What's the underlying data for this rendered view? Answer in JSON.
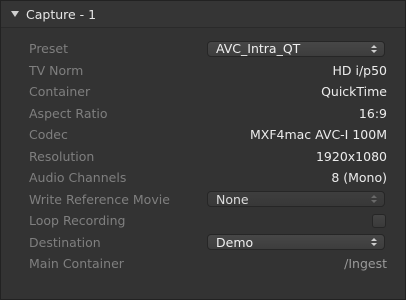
{
  "header": {
    "title": "Capture - 1"
  },
  "rows": {
    "preset": {
      "label": "Preset",
      "value": "AVC_Intra_QT"
    },
    "tv_norm": {
      "label": "TV Norm",
      "value": "HD i/p50"
    },
    "container": {
      "label": "Container",
      "value": "QuickTime"
    },
    "aspect_ratio": {
      "label": "Aspect Ratio",
      "value": "16:9"
    },
    "codec": {
      "label": "Codec",
      "value": "MXF4mac AVC-I 100M"
    },
    "resolution": {
      "label": "Resolution",
      "value": "1920x1080"
    },
    "audio_channels": {
      "label": "Audio Channels",
      "value": "8 (Mono)"
    },
    "write_reference_movie": {
      "label": "Write Reference Movie",
      "value": "None"
    },
    "loop_recording": {
      "label": "Loop Recording",
      "checked": false
    },
    "destination": {
      "label": "Destination",
      "value": "Demo"
    },
    "main_container": {
      "label": "Main Container",
      "value": "/Ingest"
    }
  }
}
